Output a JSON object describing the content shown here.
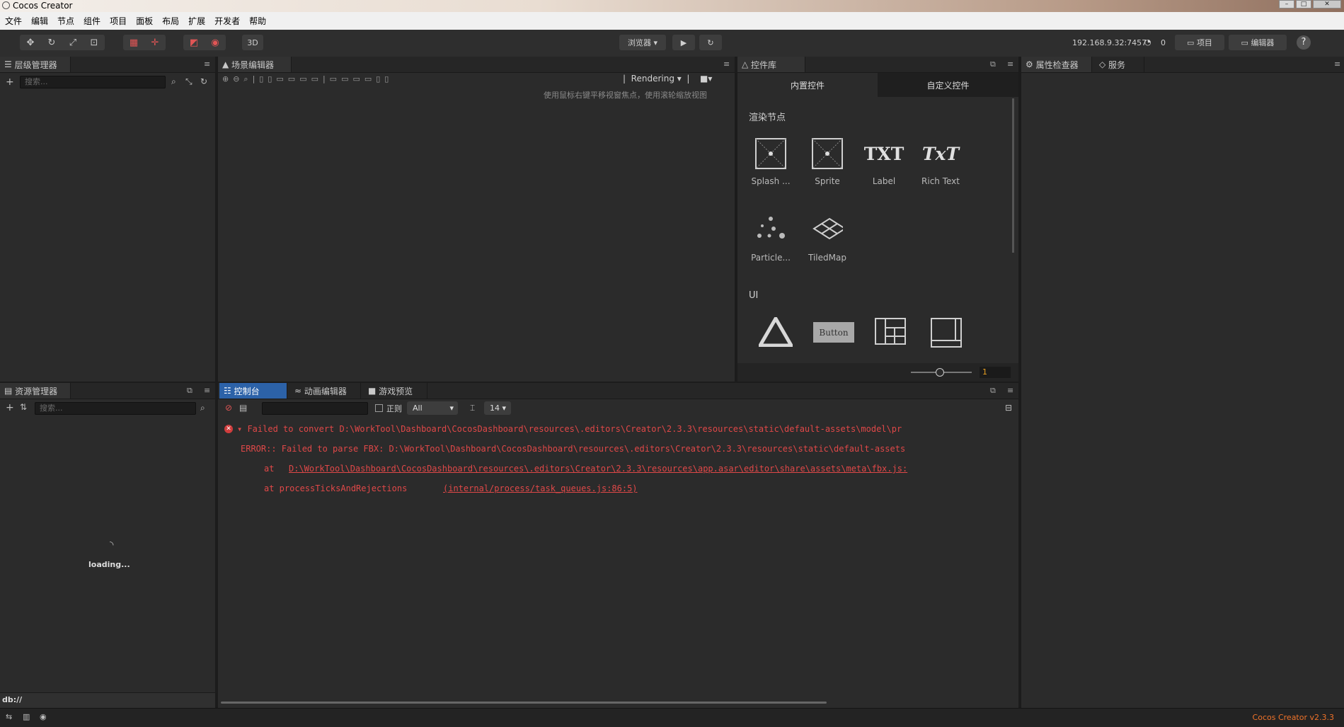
{
  "window": {
    "title": "Cocos Creator"
  },
  "menu": [
    "文件",
    "编辑",
    "节点",
    "组件",
    "项目",
    "面板",
    "布局",
    "扩展",
    "开发者",
    "帮助"
  ],
  "toolbar": {
    "browser_label": "浏览器 ▾",
    "mode_3d": "3D",
    "ip": "192.168.9.32:7457",
    "wifi_count": "0",
    "project_label": "项目",
    "editor_label": "编辑器",
    "help": "?"
  },
  "hierarchy": {
    "tab": "层级管理器",
    "search_placeholder": "搜索..."
  },
  "scene": {
    "tab": "场景编辑器",
    "rendering": "Rendering",
    "hint": "使用鼠标右键平移视窗焦点，使用滚轮缩放视图"
  },
  "library": {
    "tab": "控件库",
    "subtabs": [
      "内置控件",
      "自定义控件"
    ],
    "section_render": "渲染节点",
    "section_ui": "UI",
    "render_items": [
      "Splash ...",
      "Sprite",
      "Label",
      "Rich Text",
      "Particle...",
      "TiledMap"
    ],
    "ui_button_text": "Button",
    "txt_glyph": "TXT",
    "txt_rich_glyph": "TxT",
    "zoom_value": "1"
  },
  "inspector": {
    "tabs": [
      "属性检查器",
      "服务"
    ]
  },
  "assets": {
    "tab": "资源管理器",
    "search_placeholder": "搜索...",
    "loading": "loading...",
    "path": "db://"
  },
  "console": {
    "tabs": [
      "控制台",
      "动画编辑器",
      "游戏预览"
    ],
    "regex_label": "正则",
    "level": "All",
    "font_size": "14",
    "lines": [
      "▾ Failed to convert D:\\WorkTool\\Dashboard\\CocosDashboard\\resources\\.editors\\Creator\\2.3.3\\resources\\static\\default-assets\\model\\pr",
      "ERROR:: Failed to parse FBX: D:\\WorkTool\\Dashboard\\CocosDashboard\\resources\\.editors\\Creator\\2.3.3\\resources\\static\\default-assets",
      "at ",
      "D:\\WorkTool\\Dashboard\\CocosDashboard\\resources\\.editors\\Creator\\2.3.3\\resources\\app.asar\\editor\\share\\assets\\meta\\fbx.js:",
      "at processTicksAndRejections ",
      "(internal/process/task_queues.js:86:5)"
    ]
  },
  "status": {
    "version": "Cocos Creator v2.3.3"
  },
  "colors": {
    "accent": "#2c62a8",
    "error": "#e04848",
    "version": "#f0732a"
  }
}
